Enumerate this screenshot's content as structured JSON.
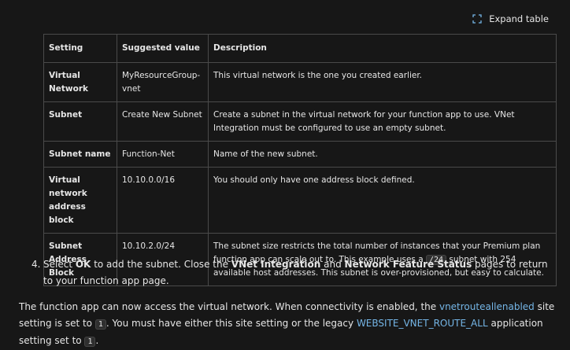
{
  "expand": {
    "label": "Expand table",
    "icon": "expand-icon"
  },
  "table": {
    "headers": [
      "Setting",
      "Suggested value",
      "Description"
    ],
    "rows": [
      {
        "setting": "Virtual Network",
        "value": "MyResourceGroup-vnet",
        "description": "This virtual network is the one you created earlier."
      },
      {
        "setting": "Subnet",
        "value": "Create New Subnet",
        "description": "Create a subnet in the virtual network for your function app to use. VNet Integration must be configured to use an empty subnet."
      },
      {
        "setting": "Subnet name",
        "value": "Function-Net",
        "description": "Name of the new subnet."
      },
      {
        "setting": "Virtual network address block",
        "value": "10.10.0.0/16",
        "description": "You should only have one address block defined."
      },
      {
        "setting": "Subnet Address Block",
        "value": "10.10.2.0/24",
        "description_part1": "The subnet size restricts the total number of instances that your Premium plan function app can scale out to. This example uses a",
        "description_code": "/24",
        "description_part2": "subnet with 254 available host addresses. This subnet is over-provisioned, but easy to calculate."
      }
    ]
  },
  "step4": {
    "number": "4.",
    "t1": "Select",
    "b1": "OK",
    "t2": "to add the subnet. Close the",
    "b2": "VNet Integration",
    "t3": "and",
    "b3": "Network Feature Status",
    "t4": "pages to return to your function app page."
  },
  "paragraph": {
    "t1": "The function app can now access the virtual network. When connectivity is enabled, the",
    "link1": "vnetrouteallenabled",
    "t2": "site setting is set to",
    "code1": "1",
    "t3": ". You must have either this site setting or the legacy",
    "link2": "WEBSITE_VNET_ROUTE_ALL",
    "t4": "application setting set to",
    "code2": "1",
    "t5": "."
  }
}
